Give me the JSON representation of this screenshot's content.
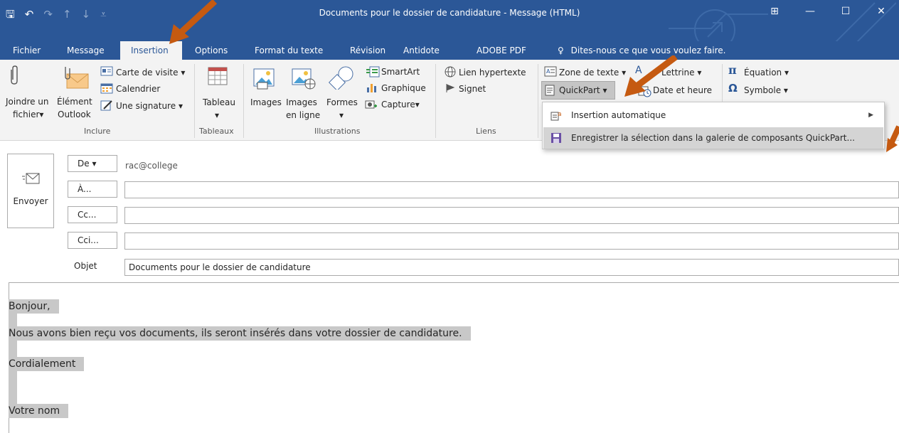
{
  "window": {
    "title": "Documents pour le dossier de candidature - Message (HTML)",
    "qat": {
      "save": "🖫",
      "undo": "↶",
      "redo": "↷",
      "up": "↑",
      "down": "↓",
      "customize": "⩡"
    },
    "buttons": {
      "ribbon_display": "⊞",
      "minimize": "—",
      "maximize": "☐",
      "close": "✕"
    }
  },
  "tabs": [
    "Fichier",
    "Message",
    "Insertion",
    "Options",
    "Format du texte",
    "Révision",
    "Antidote",
    "ADOBE PDF"
  ],
  "active_tab": "Insertion",
  "tell_me": {
    "icon": "♀",
    "text": "Dites-nous ce que vous voulez faire."
  },
  "ribbon": {
    "inclure": {
      "label": "Inclure",
      "joindre_line1": "Joindre un",
      "joindre_line2": "fichier",
      "element_line1": "Élément",
      "element_line2": "Outlook",
      "carte": "Carte de visite",
      "calendrier": "Calendrier",
      "signature": "Une signature"
    },
    "tableaux": {
      "label": "Tableaux",
      "tableau": "Tableau"
    },
    "illustrations": {
      "label": "Illustrations",
      "images": "Images",
      "images_ligne_1": "Images",
      "images_ligne_2": "en ligne",
      "formes": "Formes",
      "smartart": "SmartArt",
      "graphique": "Graphique",
      "capture": "Capture"
    },
    "liens": {
      "label": "Liens",
      "lien": "Lien hypertexte",
      "signet": "Signet"
    },
    "texte": {
      "zone": "Zone de texte",
      "lettrine": "Lettrine",
      "quickpart": "QuickPart",
      "date": "Date et heure"
    },
    "symboles": {
      "equation": "Équation",
      "symbole": "Symbole"
    },
    "dropdown_marker": "▾"
  },
  "quickpart_menu": {
    "items": [
      {
        "label": "Insertion automatique",
        "has_submenu": true
      },
      {
        "label": "Enregistrer la sélection dans la galerie de composants QuickPart...",
        "has_submenu": false
      }
    ]
  },
  "header": {
    "send": "Envoyer",
    "from_button": "De",
    "from_value": "rac@college",
    "to_button": "À...",
    "cc_button": "Cc...",
    "bcc_button": "Cci...",
    "subject_label": "Objet",
    "subject_value": "Documents pour le dossier de candidature"
  },
  "body": {
    "lines": [
      "Bonjour,",
      "Nous avons bien reçu vos documents, ils seront insérés dans votre dossier de candidature.",
      "Cordialement",
      "Votre nom"
    ]
  },
  "colors": {
    "titlebar": "#2b5797",
    "ribbon": "#f3f3f3",
    "arrow": "#c55a11",
    "selection": "#c8c8c8"
  }
}
